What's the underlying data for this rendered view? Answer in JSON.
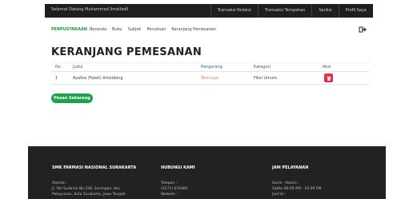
{
  "topbar": {
    "welcome": "Selamat Datang Muhammad Ilmalfadil",
    "links": [
      "Transaksi Koleksi",
      "Transaksi Tempahan",
      "Sanksi",
      "Profil Saya"
    ]
  },
  "nav": {
    "brand": "PERPUSTAKAAN",
    "menu": [
      "Beranda",
      "Buku",
      "Subjek",
      "Penulisan",
      "Keranjang Pemesanan"
    ],
    "logout_icon": "logout-icon"
  },
  "page": {
    "title": "KERANJANG PEMESANAN"
  },
  "table": {
    "headers": [
      "No",
      "Judul",
      "Pengarang",
      "Kategori",
      "Aksi"
    ],
    "rows": [
      {
        "no": "1",
        "judul": "Ayatka (Fabel) Ambidang",
        "pengarang": "Tere Liye",
        "kategori": "Fiksi Umum"
      }
    ]
  },
  "actions": {
    "pesan": "Pesan Sekarang",
    "delete_icon": "trash-icon"
  },
  "footer": {
    "col1": {
      "title": "SMK FARMASI NASIONAL SURAKARTA",
      "label": "Alamat :",
      "line1": "Jl. Yos Sudarso No.338, Serengan, Kec.",
      "line2": "Pakayunan, Kota Surakarta, Jawa Tengah"
    },
    "col2": {
      "title": "HUBUNGI KAMI",
      "label": "Telepon :",
      "phone": "(0271) 635883",
      "label2": "Website :"
    },
    "col3": {
      "title": "JAM PELAYANAN",
      "label": "Senin - Kamis :",
      "hours": "Sabtu 08:00 AM - 16:00 PM",
      "label2": "Jum'at :"
    }
  },
  "colors": {
    "accent": "#1aa44a",
    "danger": "#e0314a",
    "dark": "#222222"
  }
}
